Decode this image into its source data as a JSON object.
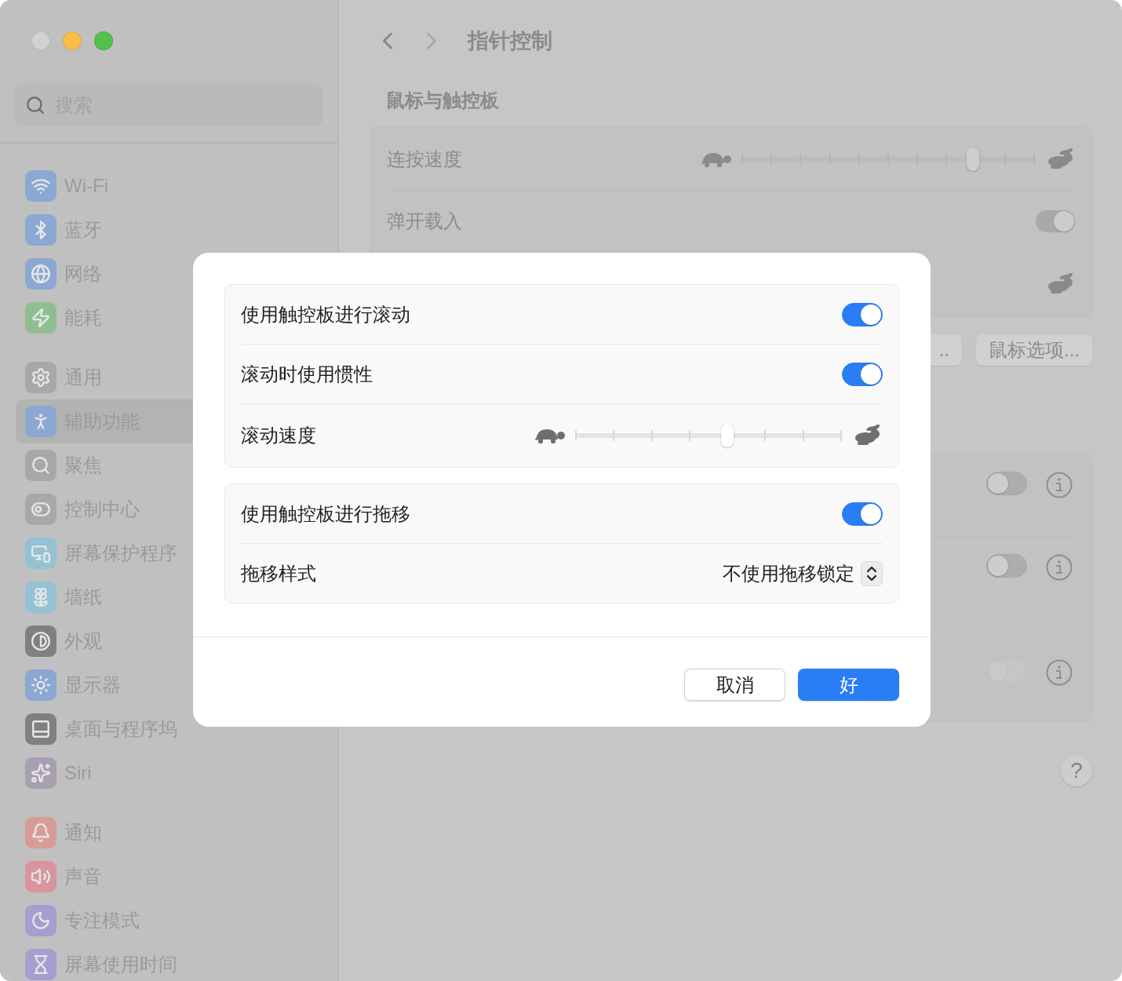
{
  "sidebar": {
    "search": {
      "placeholder": "搜索"
    },
    "groups": [
      [
        {
          "label": "Wi-Fi",
          "color": "#8aa8d3",
          "selected": false
        },
        {
          "label": "蓝牙",
          "color": "#8aa8d3",
          "selected": false
        },
        {
          "label": "网络",
          "color": "#8aa8d3",
          "selected": false
        },
        {
          "label": "能耗",
          "color": "#90bf8f",
          "selected": false
        }
      ],
      [
        {
          "label": "通用",
          "color": "#a8a8a8",
          "selected": false
        },
        {
          "label": "辅助功能",
          "color": "#8aa8d3",
          "selected": true
        },
        {
          "label": "聚焦",
          "color": "#a8a8a8",
          "selected": false
        },
        {
          "label": "控制中心",
          "color": "#a8a8a8",
          "selected": false
        },
        {
          "label": "屏幕保护程序",
          "color": "#94c2d4",
          "selected": false
        },
        {
          "label": "墙纸",
          "color": "#94c2d4",
          "selected": false
        },
        {
          "label": "外观",
          "color": "#808080",
          "selected": false
        },
        {
          "label": "显示器",
          "color": "#8aa8d3",
          "selected": false
        },
        {
          "label": "桌面与程序坞",
          "color": "#808080",
          "selected": false
        },
        {
          "label": "Siri",
          "color": "#a89fb0",
          "selected": false
        }
      ],
      [
        {
          "label": "通知",
          "color": "#d89c98",
          "selected": false
        },
        {
          "label": "声音",
          "color": "#d8959d",
          "selected": false
        },
        {
          "label": "专注模式",
          "color": "#a59ecf",
          "selected": false
        },
        {
          "label": "屏幕使用时间",
          "color": "#a59ecf",
          "selected": false
        }
      ]
    ]
  },
  "toolbar": {
    "title": "指针控制"
  },
  "section": {
    "heading": "鼠标与触控板",
    "rows": [
      {
        "kind": "slider",
        "label": "连按速度",
        "level": 0.79
      },
      {
        "kind": "toggle",
        "label": "弹开载入",
        "on": true,
        "disabled": true
      },
      {
        "kind": "covered_slider"
      }
    ],
    "buttons": [
      {
        "label": ".."
      },
      {
        "label": "鼠标选项..."
      }
    ]
  },
  "second_card": {
    "rows": [
      {
        "on": false,
        "disabled": false
      },
      {
        "on": false,
        "disabled": false
      },
      {
        "on": false,
        "disabled": true
      }
    ]
  },
  "help_button": {
    "label": "?"
  },
  "dialog": {
    "groups": [
      [
        {
          "kind": "toggle",
          "label": "使用触控板进行滚动",
          "on": true
        },
        {
          "kind": "toggle",
          "label": "滚动时使用惯性",
          "on": true
        },
        {
          "kind": "slider",
          "label": "滚动速度",
          "level": 0.57
        }
      ],
      [
        {
          "kind": "toggle",
          "label": "使用触控板进行拖移",
          "on": true
        },
        {
          "kind": "popup",
          "label": "拖移样式",
          "value": "不使用拖移锁定"
        }
      ]
    ],
    "buttons": [
      {
        "label": "取消",
        "kind": "secondary"
      },
      {
        "label": "好",
        "kind": "primary"
      }
    ]
  }
}
